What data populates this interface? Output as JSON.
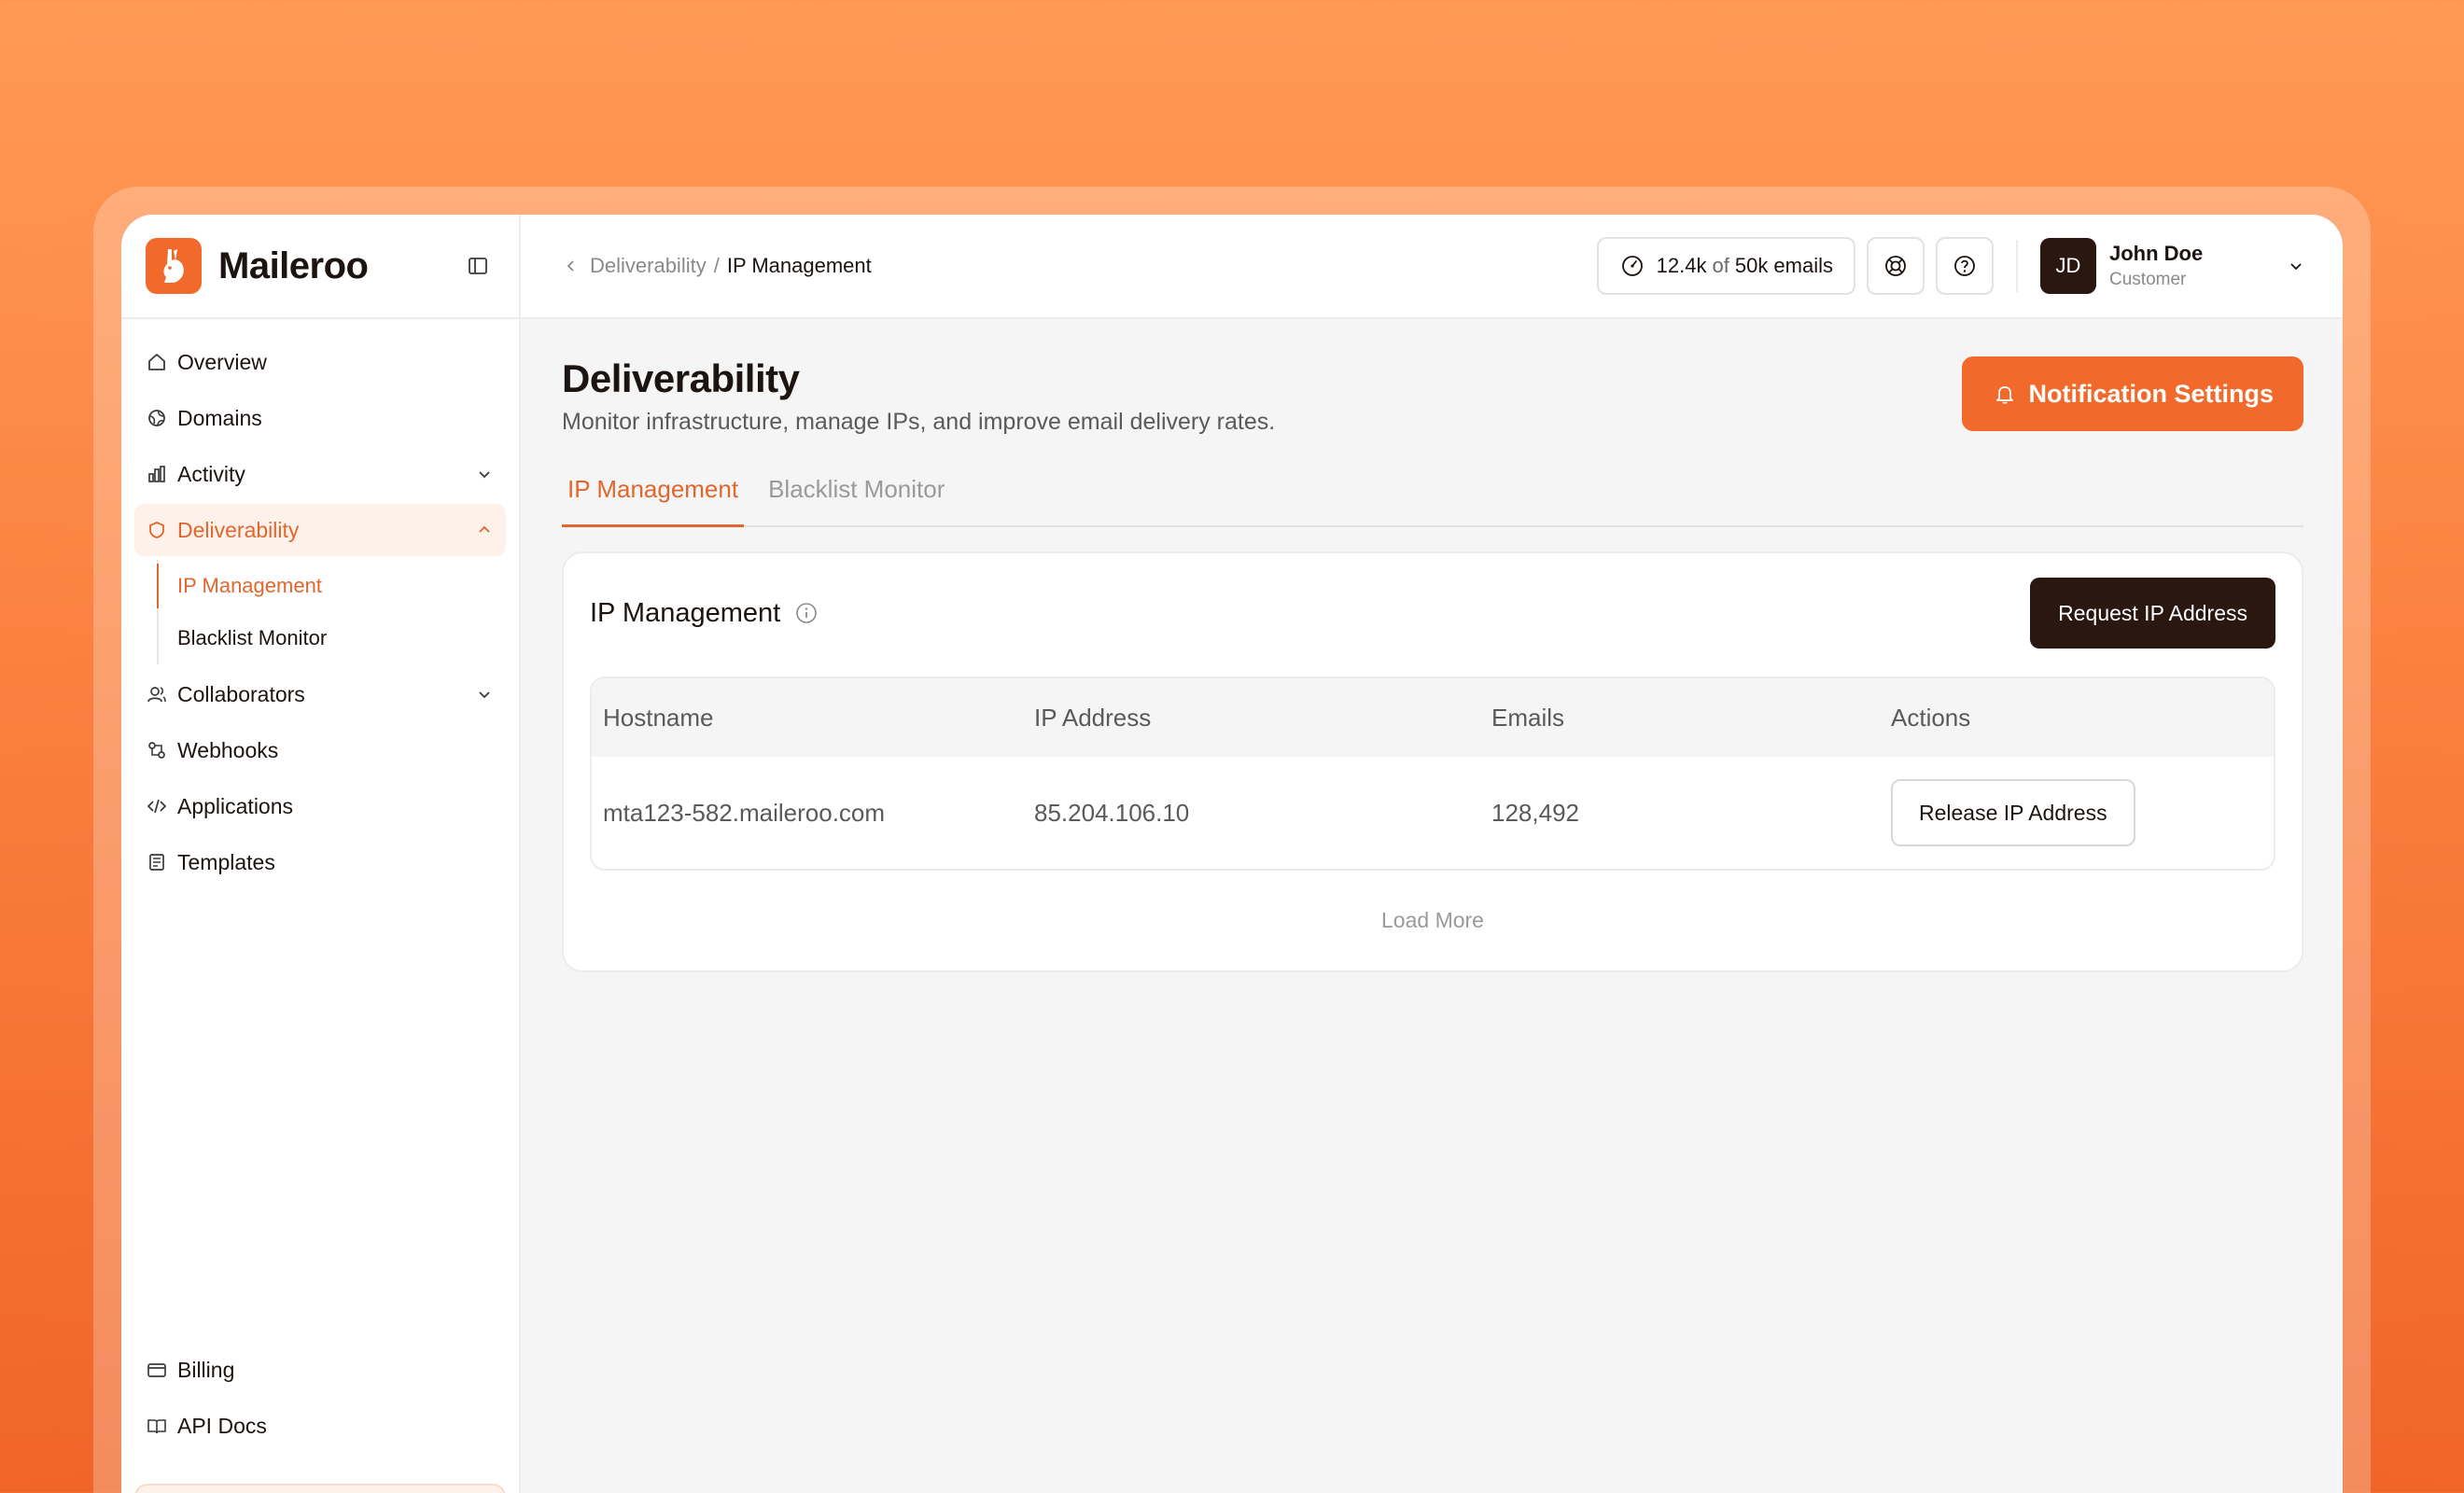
{
  "brand": {
    "name": "Maileroo"
  },
  "sidebar": {
    "items": [
      {
        "label": "Overview"
      },
      {
        "label": "Domains"
      },
      {
        "label": "Activity"
      },
      {
        "label": "Deliverability"
      },
      {
        "label": "Collaborators"
      },
      {
        "label": "Webhooks"
      },
      {
        "label": "Applications"
      },
      {
        "label": "Templates"
      }
    ],
    "deliverability_sub": [
      {
        "label": "IP Management"
      },
      {
        "label": "Blacklist Monitor"
      }
    ],
    "bottom": [
      {
        "label": "Billing"
      },
      {
        "label": "API Docs"
      }
    ]
  },
  "topbar": {
    "breadcrumb": {
      "parent": "Deliverability",
      "separator": "/",
      "current": "IP Management"
    },
    "usage": {
      "used": "12.4k",
      "of": "of",
      "total": "50k emails"
    },
    "user": {
      "initials": "JD",
      "name": "John Doe",
      "role": "Customer"
    }
  },
  "page": {
    "title": "Deliverability",
    "subtitle": "Monitor infrastructure, manage IPs, and improve email delivery rates.",
    "notification_button": "Notification Settings",
    "tabs": [
      {
        "label": "IP Management"
      },
      {
        "label": "Blacklist Monitor"
      }
    ]
  },
  "card": {
    "title": "IP Management",
    "request_button": "Request IP Address",
    "columns": [
      "Hostname",
      "IP Address",
      "Emails",
      "Actions"
    ],
    "rows": [
      {
        "hostname": "mta123-582.maileroo.com",
        "ip": "85.204.106.10",
        "emails": "128,492",
        "action": "Release IP Address"
      }
    ],
    "load_more": "Load More"
  },
  "colors": {
    "accent": "#f26a2b",
    "dark": "#2a1710",
    "active_nav_bg": "#fdf1ea"
  }
}
